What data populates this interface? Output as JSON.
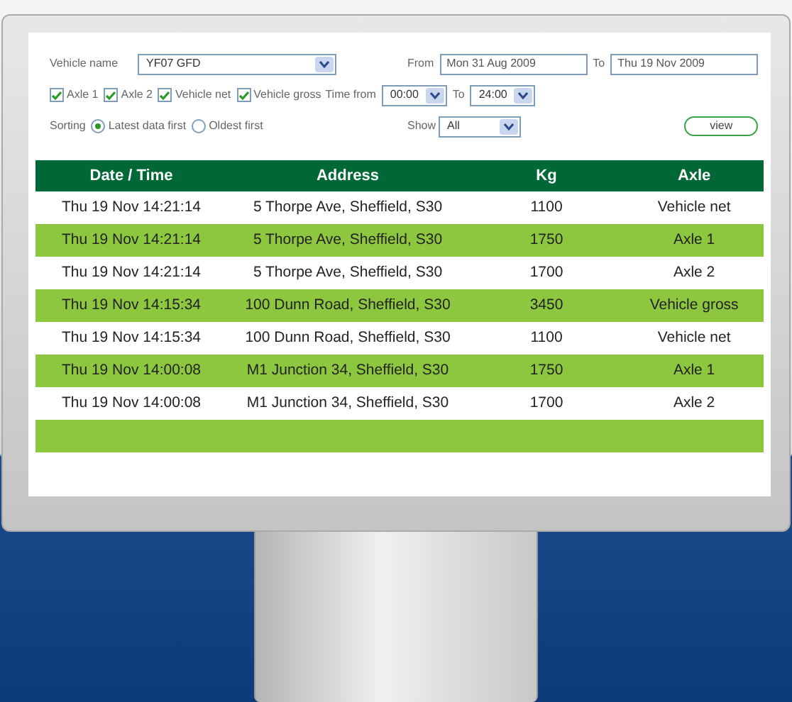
{
  "form": {
    "vehicle_name": {
      "label": "Vehicle name",
      "value": "YF07 GFD"
    },
    "from": {
      "label": "From",
      "value": "Mon 31 Aug 2009"
    },
    "to": {
      "label": "To",
      "value": "Thu 19 Nov 2009"
    },
    "checkboxes": [
      {
        "label": "Axle 1",
        "checked": true
      },
      {
        "label": "Axle 2",
        "checked": true
      },
      {
        "label": "Vehicle net",
        "checked": true
      },
      {
        "label": "Vehicle gross",
        "checked": true
      }
    ],
    "time_from": {
      "label": "Time from",
      "value": "00:00"
    },
    "time_to": {
      "label": "To",
      "value": "24:00"
    },
    "sorting": {
      "label": "Sorting",
      "options": [
        {
          "label": "Latest data first",
          "selected": true
        },
        {
          "label": "Oldest first",
          "selected": false
        }
      ]
    },
    "show": {
      "label": "Show",
      "value": "All"
    },
    "view_button": "view"
  },
  "table": {
    "columns": [
      "Date / Time",
      "Address",
      "Kg",
      "Axle"
    ],
    "rows": [
      [
        "Thu 19 Nov 14:21:14",
        "5 Thorpe Ave, Sheffield, S30",
        "1100",
        "Vehicle net"
      ],
      [
        "Thu 19 Nov 14:21:14",
        "5 Thorpe Ave, Sheffield, S30",
        "1750",
        "Axle 1"
      ],
      [
        "Thu 19 Nov 14:21:14",
        "5 Thorpe Ave, Sheffield, S30",
        "1700",
        "Axle 2"
      ],
      [
        "Thu 19 Nov 14:15:34",
        "100 Dunn Road, Sheffield, S30",
        "3450",
        "Vehicle gross"
      ],
      [
        "Thu 19 Nov 14:15:34",
        "100 Dunn Road, Sheffield, S30",
        "1100",
        "Vehicle net"
      ],
      [
        "Thu 19 Nov 14:00:08",
        "M1 Junction 34, Sheffield, S30",
        "1750",
        "Axle 1"
      ],
      [
        "Thu 19 Nov 14:00:08",
        "M1 Junction 34, Sheffield, S30",
        "1700",
        "Axle 2"
      ]
    ]
  }
}
